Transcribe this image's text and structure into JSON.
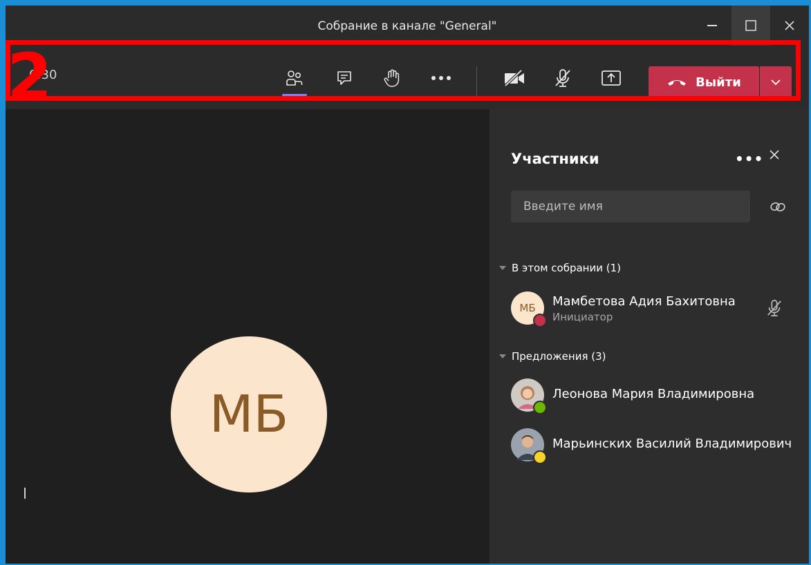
{
  "window": {
    "title": "Собрание в канале \"General\""
  },
  "toolbar": {
    "timer": "0:30",
    "leave_label": "Выйти"
  },
  "annotation": {
    "number": "2"
  },
  "stage": {
    "avatar_initials": "МБ"
  },
  "panel": {
    "title": "Участники",
    "search_placeholder": "Введите имя",
    "in_meeting_header": "В этом собрании (1)",
    "suggestions_header": "Предложения (3)",
    "in_meeting": [
      {
        "initials": "МБ",
        "name": "Мамбетова Адия Бахитовна",
        "role": "Инициатор",
        "status_color": "#c4314b"
      }
    ],
    "suggestions": [
      {
        "name": "Леонова Мария Владимировна",
        "status_color": "#6bb700"
      },
      {
        "name": "Марьинских Василий Владимирович",
        "status_color": "#f8d22a"
      }
    ]
  },
  "colors": {
    "accent": "#7f85f5",
    "leave": "#c4314b",
    "highlight": "#ff0000",
    "avatar_bg": "#fce5cd",
    "avatar_text": "#8a5a27"
  }
}
